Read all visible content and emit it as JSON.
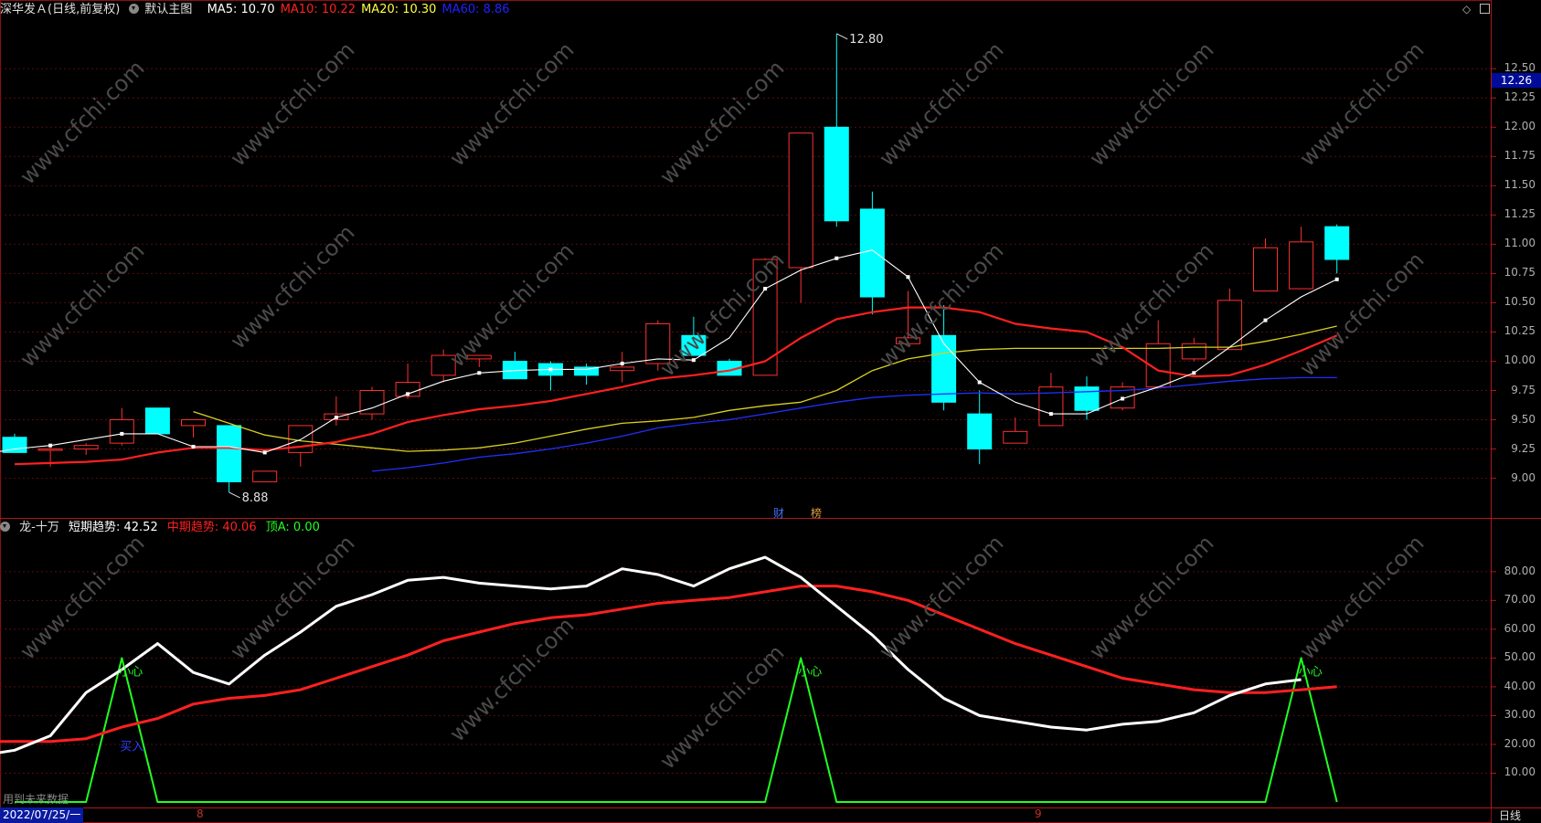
{
  "header": {
    "stock_name": "深华发Ａ(日线,前复权)",
    "template": "默认主图",
    "ma": [
      {
        "label": "MA5: 10.70",
        "color": "#ffffff"
      },
      {
        "label": "MA10: 10.22",
        "color": "#ff2020"
      },
      {
        "label": "MA20: 10.30",
        "color": "#ffff40"
      },
      {
        "label": "MA60: 8.86",
        "color": "#2020ff"
      }
    ]
  },
  "main_axis": {
    "ticks": [
      "12.50",
      "12.25",
      "12.00",
      "11.75",
      "11.50",
      "11.25",
      "11.00",
      "10.75",
      "10.50",
      "10.25",
      "10.00",
      "9.75",
      "9.50",
      "9.25",
      "9.00"
    ],
    "current_price": "12.26",
    "high_annotation": "12.80",
    "low_annotation": "8.88"
  },
  "badges": [
    {
      "label": "财",
      "color": "#4070ff"
    },
    {
      "label": "榜",
      "color": "#e0a040"
    }
  ],
  "indicator": {
    "name": "龙-十万",
    "short": {
      "label": "短期趋势: 42.52",
      "color": "#ffffff"
    },
    "mid": {
      "label": "中期趋势: 40.06",
      "color": "#ff2020"
    },
    "top": {
      "label": "顶A: 0.00",
      "color": "#20ff20"
    },
    "ticks": [
      "80.00",
      "70.00",
      "60.00",
      "50.00",
      "40.00",
      "30.00",
      "20.00",
      "10.00"
    ],
    "signal_text": "小心",
    "buy_text": "买入"
  },
  "footer": {
    "future_data": "用到未来数据",
    "date": "2022/07/25/一",
    "month_8": "8",
    "month_9": "9",
    "period": "日线"
  },
  "watermark": "www.cfchi.com",
  "chart_data": {
    "type": "candlestick",
    "price_range": [
      8.7,
      12.9
    ],
    "candles": [
      {
        "o": 9.35,
        "h": 9.38,
        "l": 9.22,
        "c": 9.22
      },
      {
        "o": 9.25,
        "h": 9.28,
        "l": 9.1,
        "c": 9.25
      },
      {
        "o": 9.25,
        "h": 9.3,
        "l": 9.2,
        "c": 9.28
      },
      {
        "o": 9.3,
        "h": 9.6,
        "l": 9.28,
        "c": 9.5
      },
      {
        "o": 9.6,
        "h": 9.6,
        "l": 9.38,
        "c": 9.38
      },
      {
        "o": 9.45,
        "h": 9.5,
        "l": 9.35,
        "c": 9.5
      },
      {
        "o": 9.45,
        "h": 9.45,
        "l": 8.88,
        "c": 8.97
      },
      {
        "o": 8.97,
        "h": 9.06,
        "l": 8.97,
        "c": 9.06
      },
      {
        "o": 9.22,
        "h": 9.45,
        "l": 9.1,
        "c": 9.45
      },
      {
        "o": 9.5,
        "h": 9.7,
        "l": 9.45,
        "c": 9.55
      },
      {
        "o": 9.55,
        "h": 9.78,
        "l": 9.5,
        "c": 9.75
      },
      {
        "o": 9.7,
        "h": 9.98,
        "l": 9.68,
        "c": 9.82
      },
      {
        "o": 9.88,
        "h": 10.1,
        "l": 9.82,
        "c": 10.05
      },
      {
        "o": 10.02,
        "h": 10.05,
        "l": 9.95,
        "c": 10.05
      },
      {
        "o": 10.0,
        "h": 10.08,
        "l": 9.85,
        "c": 9.85
      },
      {
        "o": 9.98,
        "h": 10.0,
        "l": 9.75,
        "c": 9.88
      },
      {
        "o": 9.95,
        "h": 9.98,
        "l": 9.8,
        "c": 9.88
      },
      {
        "o": 9.92,
        "h": 10.08,
        "l": 9.82,
        "c": 9.95
      },
      {
        "o": 9.98,
        "h": 10.35,
        "l": 9.92,
        "c": 10.32
      },
      {
        "o": 10.22,
        "h": 10.38,
        "l": 10.08,
        "c": 10.05
      },
      {
        "o": 10.0,
        "h": 10.02,
        "l": 9.88,
        "c": 9.88
      },
      {
        "o": 9.88,
        "h": 10.88,
        "l": 9.88,
        "c": 10.87
      },
      {
        "o": 10.8,
        "h": 11.95,
        "l": 10.5,
        "c": 11.95
      },
      {
        "o": 12.0,
        "h": 12.8,
        "l": 11.15,
        "c": 11.2
      },
      {
        "o": 11.3,
        "h": 11.45,
        "l": 10.4,
        "c": 10.55
      },
      {
        "o": 10.15,
        "h": 10.6,
        "l": 10.15,
        "c": 10.2
      },
      {
        "o": 10.22,
        "h": 10.48,
        "l": 9.58,
        "c": 9.65
      },
      {
        "o": 9.55,
        "h": 9.75,
        "l": 9.12,
        "c": 9.25
      },
      {
        "o": 9.3,
        "h": 9.52,
        "l": 9.3,
        "c": 9.4
      },
      {
        "o": 9.45,
        "h": 9.9,
        "l": 9.45,
        "c": 9.78
      },
      {
        "o": 9.78,
        "h": 9.87,
        "l": 9.5,
        "c": 9.58
      },
      {
        "o": 9.6,
        "h": 9.82,
        "l": 9.58,
        "c": 9.78
      },
      {
        "o": 9.78,
        "h": 10.35,
        "l": 9.78,
        "c": 10.15
      },
      {
        "o": 10.02,
        "h": 10.2,
        "l": 10.0,
        "c": 10.15
      },
      {
        "o": 10.1,
        "h": 10.62,
        "l": 10.1,
        "c": 10.52
      },
      {
        "o": 10.6,
        "h": 11.05,
        "l": 10.6,
        "c": 10.97
      },
      {
        "o": 10.62,
        "h": 11.15,
        "l": 10.62,
        "c": 11.02
      },
      {
        "o": 11.15,
        "h": 11.17,
        "l": 10.75,
        "c": 10.87
      }
    ],
    "ma5": [
      9.2,
      9.25,
      9.28,
      9.33,
      9.38,
      9.38,
      9.27,
      9.27,
      9.22,
      9.33,
      9.52,
      9.6,
      9.72,
      9.83,
      9.9,
      9.92,
      9.93,
      9.93,
      9.98,
      10.02,
      10.01,
      10.2,
      10.62,
      10.78,
      10.88,
      10.95,
      10.72,
      10.15,
      9.82,
      9.65,
      9.55,
      9.55,
      9.68,
      9.78,
      9.9,
      10.12,
      10.35,
      10.55,
      10.7
    ],
    "ma10": [
      9.12,
      9.13,
      9.14,
      9.16,
      9.22,
      9.26,
      9.26,
      9.24,
      9.27,
      9.31,
      9.38,
      9.48,
      9.54,
      9.59,
      9.62,
      9.66,
      9.72,
      9.78,
      9.85,
      9.88,
      9.92,
      10.0,
      10.2,
      10.36,
      10.42,
      10.46,
      10.46,
      10.42,
      10.32,
      10.28,
      10.25,
      10.12,
      9.92,
      9.87,
      9.88,
      9.97,
      10.09,
      10.22
    ],
    "ma20": [
      9.57,
      9.47,
      9.37,
      9.32,
      9.29,
      9.26,
      9.23,
      9.24,
      9.26,
      9.3,
      9.36,
      9.42,
      9.47,
      9.49,
      9.52,
      9.58,
      9.62,
      9.65,
      9.75,
      9.92,
      10.02,
      10.07,
      10.1,
      10.11,
      10.11,
      10.11,
      10.11,
      10.11,
      10.12,
      10.12,
      10.17,
      10.23,
      10.3
    ],
    "ma60": [
      9.06,
      9.09,
      9.13,
      9.18,
      9.21,
      9.25,
      9.3,
      9.36,
      9.43,
      9.47,
      9.5,
      9.55,
      9.6,
      9.65,
      9.69,
      9.71,
      9.72,
      9.73,
      9.72,
      9.73,
      9.74,
      9.75,
      9.77,
      9.8,
      9.83,
      9.85,
      9.86,
      9.86
    ],
    "indicator_short": [
      16,
      18,
      23,
      38,
      46,
      55,
      45,
      41,
      51,
      59,
      68,
      72,
      77,
      78,
      76,
      75,
      74,
      75,
      81,
      79,
      75,
      81,
      85,
      78,
      68,
      58,
      46,
      36,
      30,
      28,
      26,
      25,
      27,
      28,
      31,
      37,
      41,
      42.52
    ],
    "indicator_mid": [
      21,
      21,
      21,
      22,
      26,
      29,
      34,
      36,
      37,
      39,
      43,
      47,
      51,
      56,
      59,
      62,
      64,
      65,
      67,
      69,
      70,
      71,
      73,
      75,
      75,
      73,
      70,
      65,
      60,
      55,
      51,
      47,
      43,
      41,
      39,
      38,
      38,
      39,
      40.06
    ],
    "indicator_top": [
      0,
      0,
      0,
      50,
      0,
      0,
      0,
      0,
      0,
      0,
      0,
      0,
      0,
      0,
      0,
      0,
      0,
      0,
      0,
      0,
      0,
      0,
      50,
      0,
      0,
      0,
      0,
      0,
      0,
      0,
      0,
      0,
      0,
      0,
      0,
      0,
      50,
      0
    ]
  }
}
